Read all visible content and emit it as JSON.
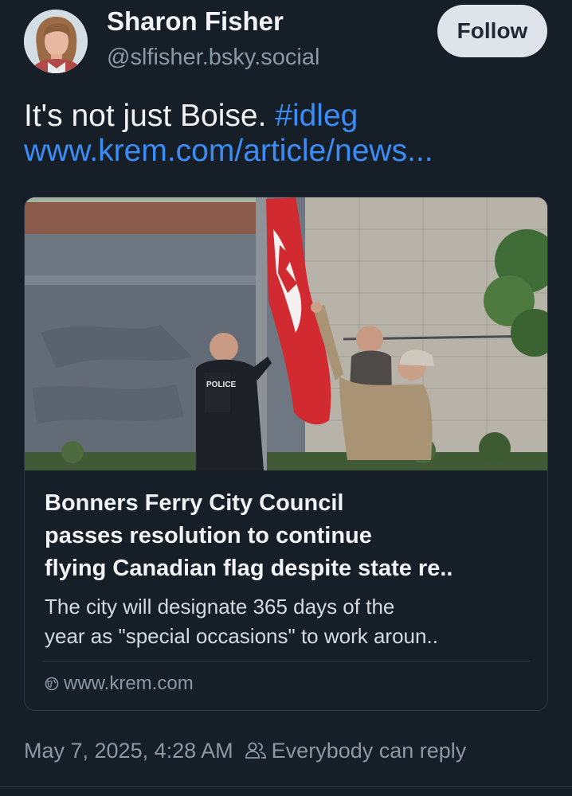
{
  "author": {
    "display_name": "Sharon Fisher",
    "handle": "@slfisher.bsky.social"
  },
  "follow_label": "Follow",
  "post": {
    "text": "It's not just Boise. ",
    "hashtag": "#idleg",
    "link_text": "www.krem.com/article/news..."
  },
  "link_card": {
    "image_text": "POLICE",
    "title_lines": [
      "Bonners Ferry City Council",
      "passes resolution to continue",
      "flying Canadian flag despite state re.."
    ],
    "description_lines": [
      "The city will designate 365 days of the",
      "year as \"special occasions\" to work aroun.."
    ],
    "domain": "www.krem.com"
  },
  "meta": {
    "timestamp": "May 7, 2025, 4:28 AM",
    "reply_setting": "Everybody can reply"
  },
  "icons": {
    "avatar": "user-avatar",
    "globe": "globe-icon",
    "people": "people-icon"
  },
  "colors": {
    "background": "#161e27",
    "link": "#3b8cf5",
    "muted": "#8b98a5",
    "follow_button": "#dfe4ea"
  }
}
